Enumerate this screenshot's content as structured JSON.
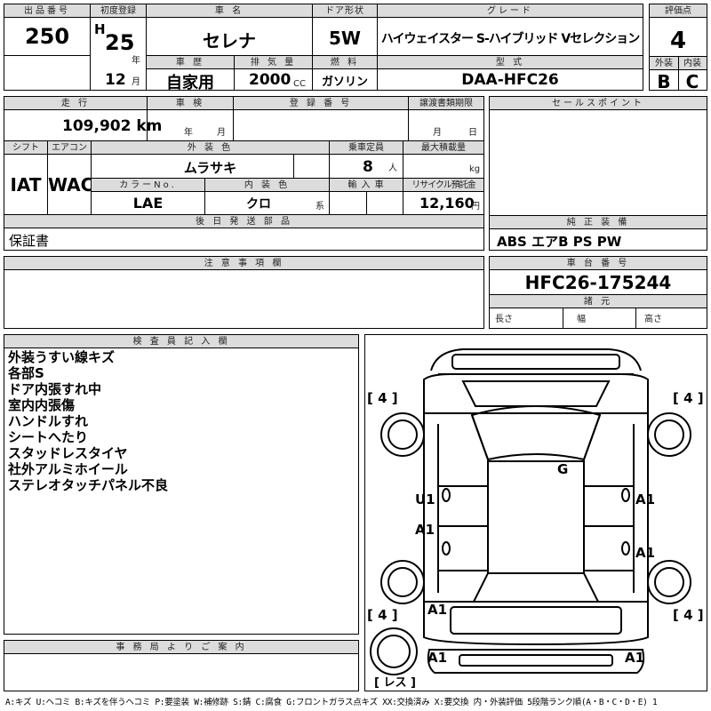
{
  "top": {
    "lot_label": "出品番号",
    "lot_no": "250",
    "reg_label": "初度登録",
    "reg_era": "H",
    "reg_year": "25",
    "reg_year_unit": "年",
    "reg_month": "12",
    "reg_month_unit": "月",
    "name_label": "車 名",
    "car_name": "セレナ",
    "door_label": "ドア形状",
    "door": "5W",
    "grade_label": "グレード",
    "grade": "ハイウェイスター S-ハイブリッド Vセレクション",
    "score_label": "評価点",
    "score": "4",
    "history_label": "車 歴",
    "history": "自家用",
    "disp_label": "排 気 量",
    "disp": "2000",
    "disp_unit": "CC",
    "fuel_label": "燃 料",
    "fuel": "ガソリン",
    "model_label": "型 式",
    "model": "DAA-HFC26",
    "ext_label": "外装",
    "ext": "B",
    "int_label": "内装",
    "int": "C"
  },
  "mid": {
    "mileage_label": "走 行",
    "mileage": "109,902 km",
    "inspection_label": "車 検",
    "insp_year": "年",
    "insp_month": "月",
    "regno_label": "登 録 番 号",
    "transfer_label": "譲渡書類期限",
    "tr_month": "月",
    "tr_day": "日",
    "shift_label": "シフト",
    "shift": "IAT",
    "ac_label": "エアコン",
    "ac": "WAC",
    "color_label": "外 装 色",
    "color": "ムラサキ",
    "capacity_label": "乗車定員",
    "capacity": "8",
    "capacity_unit": "人",
    "load_label": "最大積載量",
    "load_unit": "kg",
    "colorno_label": "カラーNo.",
    "colorno": "LAE",
    "intcolor_label": "内 装 色",
    "intcolor": "クロ",
    "intcolor_unit": "系",
    "import_label": "輸 入 車",
    "recycle_label": "リサイクル預託金",
    "recycle": "12,160",
    "recycle_unit": "円",
    "docs_label": "後 日 発 送 部 品",
    "docs": "保証書",
    "sales_label": "セールスポイント",
    "equip_label": "純 正 装 備",
    "equip": "ABS エアB PS PW",
    "notes_label": "注 意 事 項 欄",
    "chassis_label": "車 台 番 号",
    "chassis": "HFC26-175244",
    "spec_label": "諸 元",
    "len_label": "長さ",
    "wid_label": "幅",
    "hgt_label": "高さ"
  },
  "inspector": {
    "label": "検 査 員 記 入 欄",
    "notes": [
      "外装うすい線キズ",
      "各部S",
      "ドア内張すれ中",
      "室内内張傷",
      "ハンドルすれ",
      "シートへたり",
      "スタッドレスタイヤ",
      "社外アルミホイール",
      "ステレオタッチパネル不良"
    ]
  },
  "office": {
    "label": "事 務 局 よ り ご 案 内"
  },
  "diagram": {
    "tire_tl": "[ 4 ]",
    "tire_tr": "[ 4 ]",
    "tire_bl": "[ 4 ]",
    "tire_br": "[ 4 ]",
    "spare": "[ レス ]",
    "marks": {
      "g": "G",
      "u1": "U1",
      "a1_left": "A1",
      "a1_right_top": "A1",
      "a1_right_mid": "A1",
      "a1_left_lower": "A1",
      "a1_bottom_left": "A1",
      "a1_bottom_right": "A1"
    }
  },
  "footer": "A:キズ U:ヘコミ B:キズを伴うヘコミ P:要塗装 W:補修跡 S:錆 C:腐食 G:フロントガラス点キズ XX:交換済み X:要交換 内・外装評価 5段階ランク順(A・B・C・D・E) 1"
}
